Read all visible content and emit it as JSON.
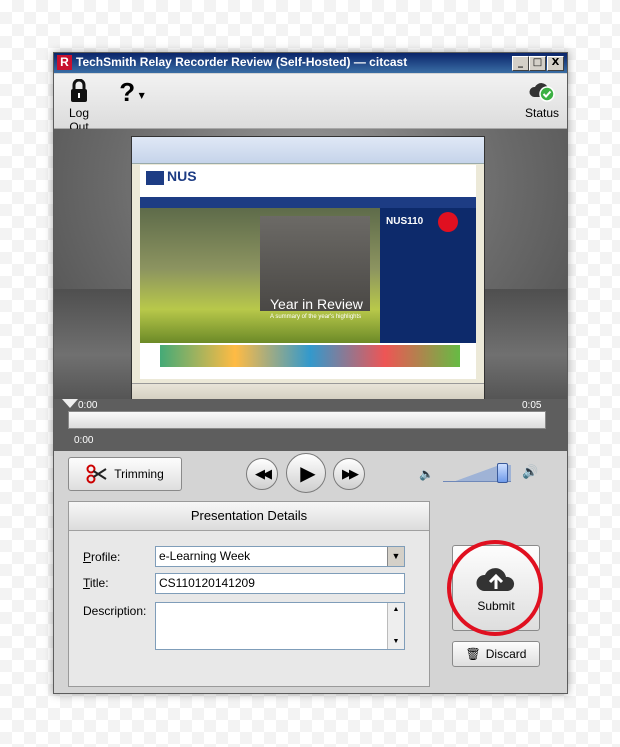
{
  "window": {
    "app_icon_letter": "R",
    "title": "TechSmith Relay Recorder Review (Self-Hosted) — citcast",
    "controls": {
      "minimize": "_",
      "maximize": "□",
      "close": "X"
    }
  },
  "toolbar": {
    "logout_label": "Log Out",
    "help_icon": "?",
    "status_label": "Status"
  },
  "timeline": {
    "start_marker": "0:00",
    "end_marker": "0:05",
    "current_time": "0:00",
    "progress": 0
  },
  "controls": {
    "trimming_label": "Trimming",
    "volume_level": 0.85
  },
  "presentation": {
    "header": "Presentation Details",
    "profile_label": "Profile:",
    "profile_value": "e-Learning Week",
    "title_label": "Title:",
    "title_value": "CS110120141209",
    "description_label": "Description:",
    "description_value": ""
  },
  "actions": {
    "submit_label": "Submit",
    "discard_label": "Discard"
  },
  "preview": {
    "site_logo": "NUS",
    "banner_title": "Year in Review",
    "banner_subtitle": "A summary of the year's highlights",
    "badge": "NUS110"
  },
  "colors": {
    "accent_red": "#e01020",
    "title_bar": "#0a246a",
    "status_green": "#3cb043"
  }
}
